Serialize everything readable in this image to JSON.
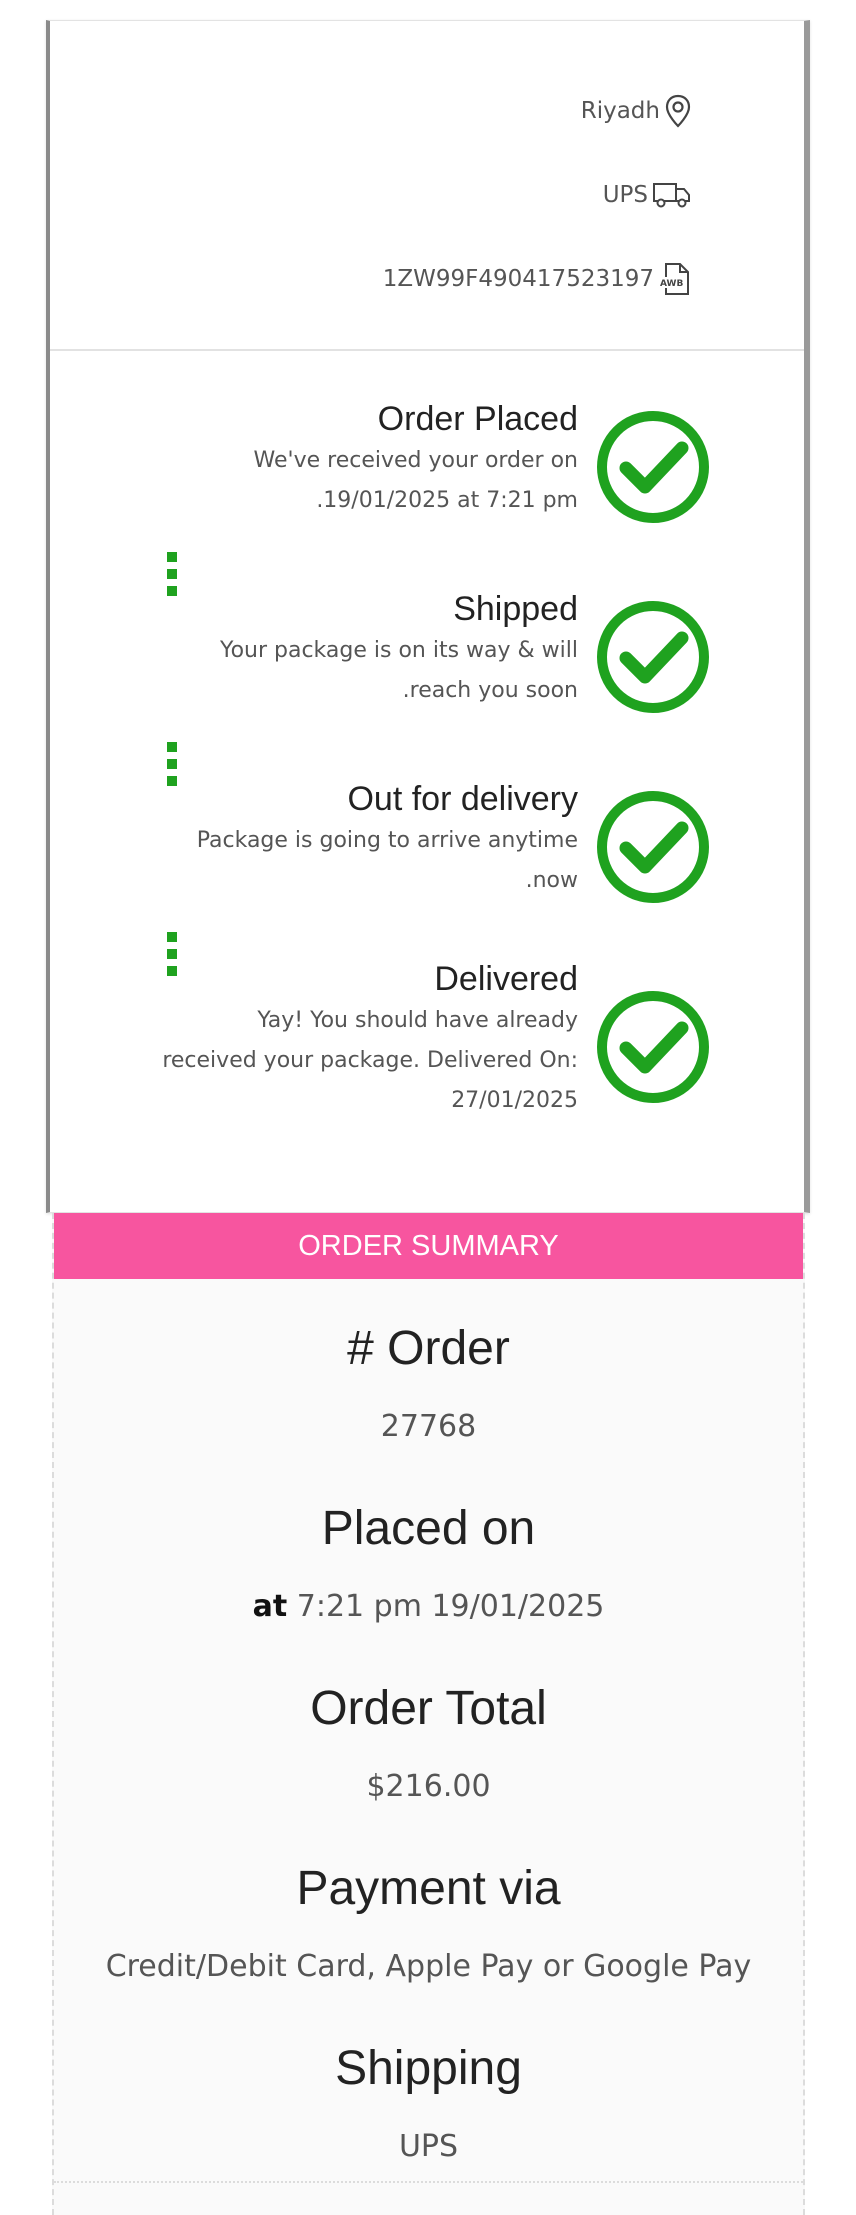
{
  "tracking": {
    "city": "Riyadh",
    "carrier": "UPS",
    "tracking_number": "1ZW99F490417523197",
    "icons": [
      "map-pin-icon",
      "truck-icon",
      "awb-document-icon"
    ]
  },
  "steps": [
    {
      "title": "Order Placed",
      "desc_lines": [
        "We've received your order on",
        ".19/01/2025 at 7:21 pm"
      ]
    },
    {
      "title": "Shipped",
      "desc_lines": [
        "Your package is on its way & will",
        ".reach you soon"
      ]
    },
    {
      "title": "Out for delivery",
      "desc_lines": [
        "Package is going to arrive anytime",
        ".now"
      ]
    },
    {
      "title": "Delivered",
      "desc_lines": [
        "Yay! You should have already",
        "received your package. Delivered On:",
        "27/01/2025"
      ]
    }
  ],
  "summary": {
    "header": "ORDER SUMMARY",
    "order_label": "# Order",
    "order_value": "27768",
    "placed_label": "Placed on",
    "placed_at_word": "at",
    "placed_value": "7:21 pm 19/01/2025",
    "total_label": "Order Total",
    "total_value": "$216.00",
    "payment_label": "Payment via",
    "payment_value": "Credit/Debit Card, Apple Pay or Google Pay",
    "shipping_label": "Shipping",
    "shipping_value": "UPS"
  },
  "colors": {
    "accent_pink": "#f7559f",
    "check_green": "#1fa21f"
  }
}
